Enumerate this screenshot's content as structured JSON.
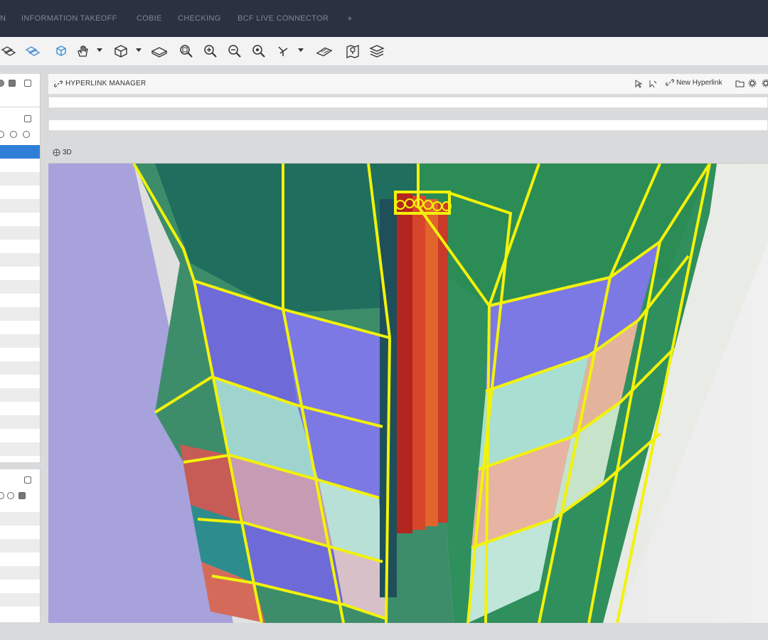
{
  "menubar": {
    "items": [
      {
        "label": "N"
      },
      {
        "label": "INFORMATION TAKEOFF"
      },
      {
        "label": "COBIE"
      },
      {
        "label": "CHECKING"
      },
      {
        "label": "BCF LIVE CONNECTOR"
      },
      {
        "label": "+"
      }
    ]
  },
  "hyperlink_manager": {
    "title": "HYPERLINK MANAGER",
    "new_button_label": "New Hyperlink"
  },
  "viewport": {
    "tab_label": "3D"
  },
  "colors": {
    "menubar_bg": "#2a3140",
    "selection": "#2f7fd8",
    "highlight_outline": "#f2f20a"
  }
}
